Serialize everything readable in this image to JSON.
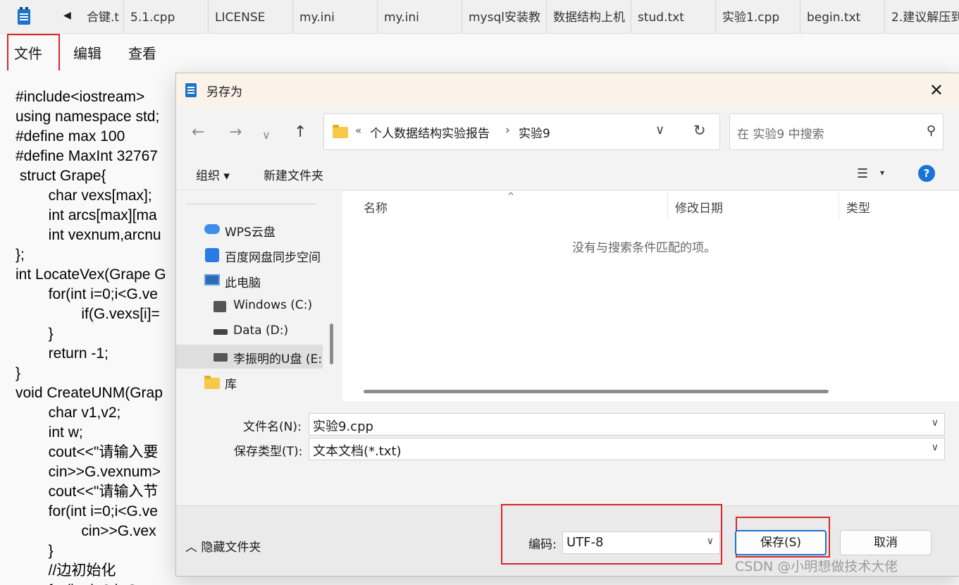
{
  "notepad": {
    "tabs": [
      "合键.t",
      "5.1.cpp",
      "LICENSE",
      "my.ini",
      "my.ini",
      "mysql安装教",
      "数据结构上机",
      "stud.txt",
      "实验1.cpp",
      "begin.txt",
      "2.建议解压到"
    ],
    "menu": {
      "file": "文件",
      "edit": "编辑",
      "view": "查看"
    },
    "code_lines": [
      "#include<iostream>",
      "using namespace std;",
      "#define max 100",
      "#define MaxInt 32767",
      " struct Grape{",
      "        char vexs[max];",
      "        int arcs[max][ma",
      "        int vexnum,arcnu",
      "};",
      "int LocateVex(Grape G",
      "        for(int i=0;i<G.ve",
      "                if(G.vexs[i]=",
      "        }",
      "        return -1;",
      "}",
      "void CreateUNM(Grap",
      "        char v1,v2;",
      "        int w;",
      "        cout<<\"请输入要",
      "        cin>>G.vexnum>",
      "        cout<<\"请输入节",
      "        for(int i=0;i<G.ve",
      "                cin>>G.vex",
      "        }",
      "        //边初始化",
      "        for(int i=0;i<G.ve"
    ]
  },
  "dialog": {
    "title": "另存为",
    "address": {
      "overflow": "«",
      "crumb1": "个人数据结构实验报告",
      "separator": "›",
      "crumb2": "实验9"
    },
    "search_placeholder": "在 实验9 中搜索",
    "toolbar": {
      "organize": "组织 ▾",
      "new_folder": "新建文件夹",
      "help": "?"
    },
    "nav_items": [
      "WPS云盘",
      "百度网盘同步空间",
      "此电脑",
      "Windows (C:)",
      "Data (D:)",
      "李振明的U盘 (E:",
      "库"
    ],
    "columns": {
      "name": "名称",
      "modified": "修改日期",
      "type": "类型"
    },
    "empty_message": "没有与搜索条件匹配的项。",
    "filename_label": "文件名(N):",
    "filename_value": "实验9.cpp",
    "filetype_label": "保存类型(T):",
    "filetype_value": "文本文档(*.txt)",
    "hide_folders": "隐藏文件夹",
    "encoding_label": "编码:",
    "encoding_value": "UTF-8",
    "save_button": "保存(S)",
    "cancel_button": "取消"
  },
  "watermark": "CSDN @小明想做技术大佬",
  "colors": {
    "highlight_box": "#d9262c",
    "primary_button_border": "#1f6fd0",
    "help_icon": "#1a73d9"
  }
}
